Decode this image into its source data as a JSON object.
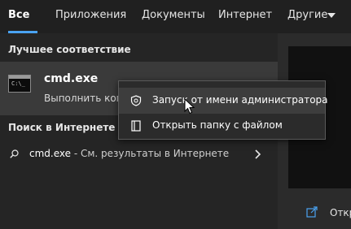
{
  "tabs": [
    {
      "label": "Все",
      "active": true
    },
    {
      "label": "Приложения"
    },
    {
      "label": "Документы"
    },
    {
      "label": "Интернет"
    },
    {
      "label": "Другие"
    }
  ],
  "best_match": {
    "section_title": "Лучшее соответствие",
    "app_title": "cmd.exe",
    "app_subtitle": "Выполнить ком",
    "icon_prompt": "C:\\_"
  },
  "web_search": {
    "section_title": "Поиск в Интернете",
    "query": "cmd.exe",
    "suffix": " - См. результаты в Интернете"
  },
  "context_menu": {
    "items": [
      {
        "label": "Запуск от имени администратора",
        "icon": "shield-icon",
        "hover": true
      },
      {
        "label": "Открыть папку с файлом",
        "icon": "folder-open-icon"
      }
    ]
  },
  "right_panel": {
    "action_label": "Откр",
    "action_icon": "open-icon"
  },
  "colors": {
    "accent": "#4aa3f2",
    "background": "#202020",
    "panel": "#252525",
    "selected": "#3a3a3a",
    "menu": "#2b2b2b"
  }
}
